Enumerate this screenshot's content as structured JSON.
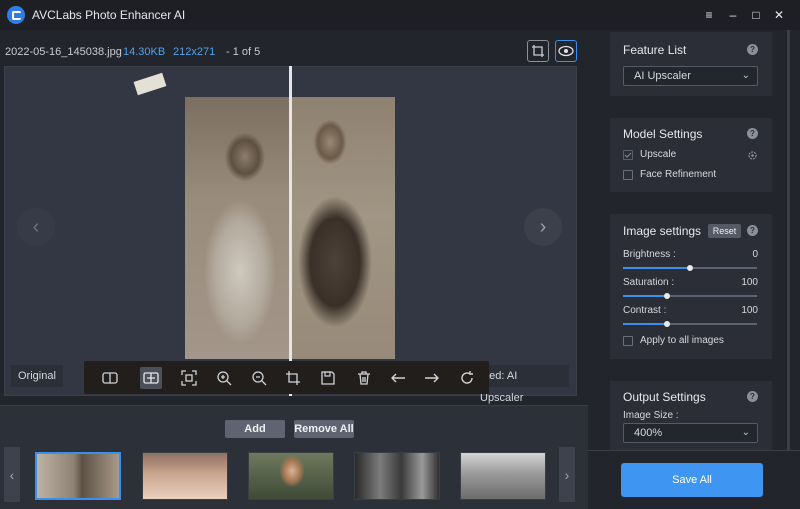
{
  "app": {
    "title": "AVCLabs Photo Enhancer AI"
  },
  "window_controls": {
    "menu": "≡",
    "minimize": "–",
    "maximize": "□",
    "close": "✕"
  },
  "file": {
    "name": "2022-05-16_145038.jpg",
    "size": "14.30KB",
    "dimensions": "212x271",
    "index": "- 1 of 5"
  },
  "viewer": {
    "original_label": "Original",
    "enhanced_label": "ated: AI Upscaler",
    "prev_arrow": "‹",
    "next_arrow": "›"
  },
  "toolbar": {
    "tools": [
      "split-view-icon",
      "compare-icon",
      "fit-screen-icon",
      "zoom-in-icon",
      "zoom-out-icon",
      "crop-icon",
      "save-icon",
      "delete-icon",
      "undo-arrow-icon",
      "redo-arrow-icon",
      "rotate-icon"
    ]
  },
  "list_actions": {
    "add": "Add",
    "remove_all": "Remove All"
  },
  "thumbnails": {
    "prev": "‹",
    "next": "›",
    "count": 5,
    "selected_index": 0
  },
  "feature_list": {
    "title": "Feature List",
    "selected": "AI Upscaler"
  },
  "model_settings": {
    "title": "Model Settings",
    "options": [
      {
        "label": "Upscale",
        "checked": true
      },
      {
        "label": "Face Refinement",
        "checked": false
      }
    ]
  },
  "image_settings": {
    "title": "Image settings",
    "reset": "Reset",
    "brightness": {
      "label": "Brightness :",
      "value": "0",
      "fraction": 0.5
    },
    "saturation": {
      "label": "Saturation :",
      "value": "100",
      "fraction": 0.33
    },
    "contrast": {
      "label": "Contrast :",
      "value": "100",
      "fraction": 0.33
    },
    "apply_all": "Apply to all images"
  },
  "output_settings": {
    "title": "Output Settings",
    "size_label": "Image Size :",
    "size_value": "400%"
  },
  "save_all": "Save All",
  "colors": {
    "accent": "#3e95f2",
    "panel": "#2b2e36",
    "background": "#22252c"
  }
}
